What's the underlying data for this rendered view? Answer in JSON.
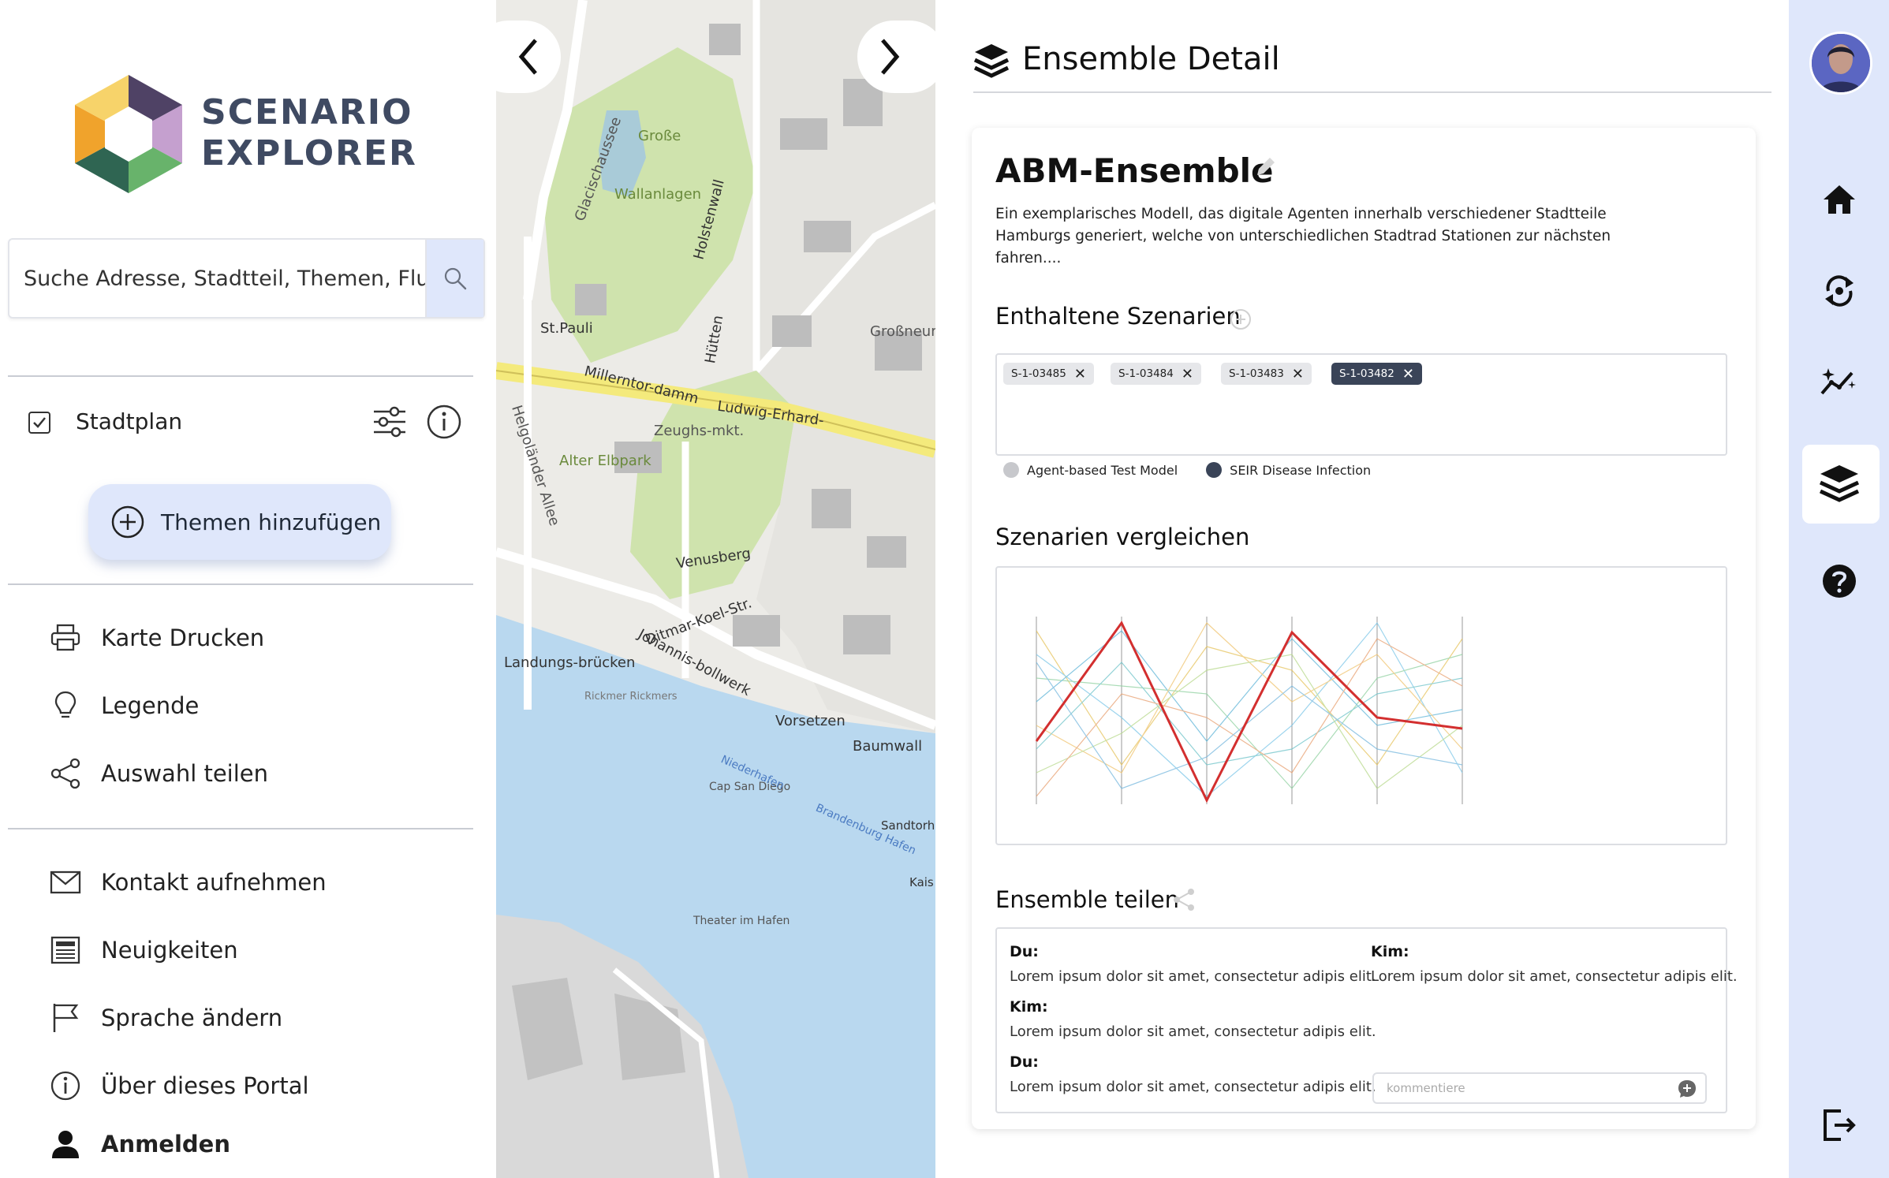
{
  "sidebar": {
    "logo_line1": "SCENARIO",
    "logo_line2": "EXPLORER",
    "search_placeholder": "Suche Adresse, Stadtteil, Themen, Flurstück",
    "layer_label": "Stadtplan",
    "themes_button": "Themen hinzufügen",
    "menu": [
      {
        "label": "Karte Drucken",
        "icon": "printer-icon"
      },
      {
        "label": "Legende",
        "icon": "lightbulb-icon"
      },
      {
        "label": "Auswahl teilen",
        "icon": "share-icon"
      },
      {
        "label": "Kontakt aufnehmen",
        "icon": "mail-icon"
      },
      {
        "label": "Neuigkeiten",
        "icon": "newspaper-icon"
      },
      {
        "label": "Sprache ändern",
        "icon": "flag-icon"
      },
      {
        "label": "Über dieses Portal",
        "icon": "info-icon"
      },
      {
        "label": "Anmelden",
        "icon": "user-icon"
      }
    ]
  },
  "map": {
    "labels": [
      "Große",
      "Wallanlagen",
      "Glacischaussee",
      "St.Pauli",
      "Millerntor-damm",
      "Ludwig-Erhard-",
      "Zeughs-mkt.",
      "Alter Elbpark",
      "Helgoländer Allee",
      "Venusberg",
      "Landungs-brücken",
      "Vorsetzen",
      "Baumwall",
      "Johannis-bollwerk",
      "Ditmar-Koel-Str.",
      "Theater im Hafen",
      "Großneumarkt",
      "Holstenwall",
      "Hütten",
      "Sandtorh",
      "Kais",
      "Cap San Diego",
      "Rickmer Rickmers",
      "Brandenburg Hafen",
      "Niederhafen"
    ]
  },
  "main": {
    "header_title": "Ensemble Detail",
    "ensemble_title": "ABM-Ensemble",
    "ensemble_description": "Ein exemplarisches Modell, das digitale Agenten innerhalb verschiedener Stadtteile Hamburgs generiert, welche von unterschiedlichen Stadtrad Stationen zur nächsten fahren....",
    "scenarios_title": "Enthaltene Szenarien",
    "scenarios": [
      {
        "id": "S-1-03485",
        "selected": false
      },
      {
        "id": "S-1-03484",
        "selected": false
      },
      {
        "id": "S-1-03483",
        "selected": false
      },
      {
        "id": "S-1-03482",
        "selected": true
      }
    ],
    "models": [
      {
        "label": "Agent-based Test Model",
        "color": "#c7c8cc"
      },
      {
        "label": "SEIR Disease Infection",
        "color": "#3a4458"
      }
    ],
    "compare_title": "Szenarien vergleichen",
    "share_title": "Ensemble teilen",
    "chat": [
      {
        "who": "Du:",
        "msg": "Lorem ipsum dolor sit amet, consectetur adipis elit."
      },
      {
        "who": "Kim:",
        "msg": "Lorem ipsum dolor sit amet, consectetur adipis elit."
      },
      {
        "who": "Du:",
        "msg": "Lorem ipsum dolor sit amet, consectetur adipis elit."
      },
      {
        "who": "Kim:",
        "msg": "Lorem ipsum dolor sit amet, consectetur adipis elit."
      }
    ],
    "comment_placeholder": "kommentiere"
  },
  "colors": {
    "accent_light": "#dfe7fb",
    "chip_dark": "#3a4458",
    "highlight_line": "#d32f2f"
  }
}
